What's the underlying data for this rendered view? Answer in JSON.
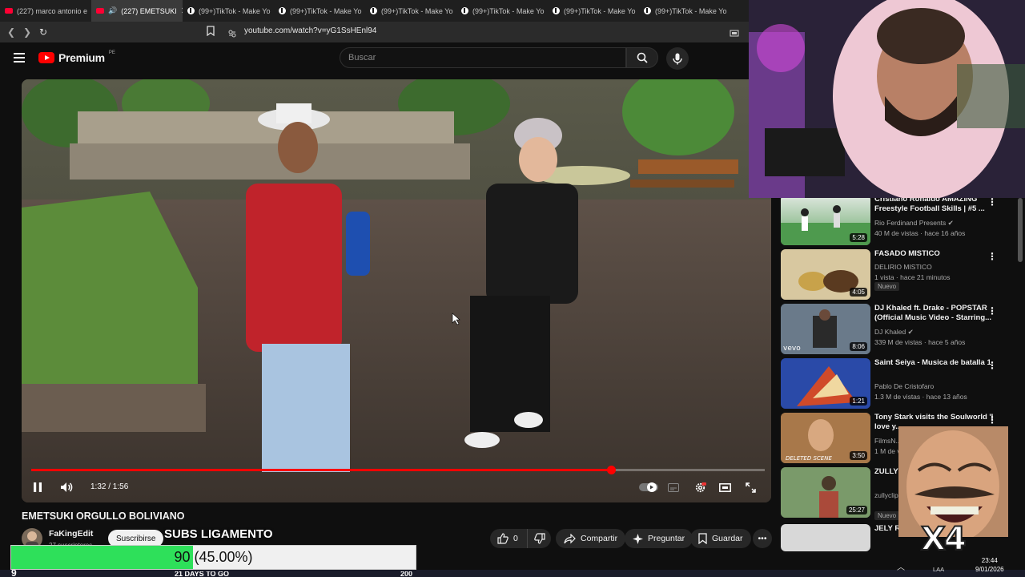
{
  "browser": {
    "tabs": [
      {
        "label": "(227) marco antonio e",
        "icon": "youtube-icon",
        "active": false
      },
      {
        "label": "(227) EMETSUKI",
        "icon": "youtube-icon",
        "active": true
      },
      {
        "label": "(99+)TikTok - Make Yo",
        "icon": "tiktok-icon",
        "active": false
      },
      {
        "label": "(99+)TikTok - Make Yo",
        "icon": "tiktok-icon",
        "active": false
      },
      {
        "label": "(99+)TikTok - Make Yo",
        "icon": "tiktok-icon",
        "active": false
      },
      {
        "label": "(99+)TikTok - Make Yo",
        "icon": "tiktok-icon",
        "active": false
      },
      {
        "label": "(99+)TikTok - Make Yo",
        "icon": "tiktok-icon",
        "active": false
      },
      {
        "label": "(99+)TikTok - Make Yo",
        "icon": "tiktok-icon",
        "active": false
      }
    ],
    "url": "youtube.com/watch?v=yG1SsHEnl94"
  },
  "youtube": {
    "logo_text": "Premium",
    "region": "PE",
    "search_placeholder": "Buscar"
  },
  "player": {
    "time": "1:32 / 1:56",
    "progress_fraction": 0.79
  },
  "video": {
    "title": "EMETSUKI ORGULLO BOLIVIANO",
    "channel": "FaKingEdit",
    "subscribers": "27 suscriptores",
    "subscribe_label": "Suscribirse",
    "likes": "0",
    "share_label": "Compartir",
    "ask_label": "Preguntar",
    "save_label": "Guardar"
  },
  "overlay": {
    "subs_caption": "SUBS LIGAMENTO",
    "goal_text": "90 (45.00%)",
    "goal_fraction": 0.45,
    "goal_sub": "21 DAYS TO GO",
    "goal_target": "200",
    "multiplier": "X4",
    "corner_number": "9"
  },
  "recommendations": [
    {
      "title": "Cristiano Ronaldo AMAZING Freestyle Football Skills | #5 ...",
      "channel": "Rio Ferdinand Presents",
      "verified": true,
      "meta": "40 M de vistas · hace 16 años",
      "duration": "5:28",
      "new": false
    },
    {
      "title": "FASADO MISTICO",
      "channel": "DELIRIO MISTICO",
      "verified": false,
      "meta": "1 vista · hace 21 minutos",
      "duration": "4:05",
      "new": true,
      "new_label": "Nuevo"
    },
    {
      "title": "DJ Khaled ft. Drake - POPSTAR (Official Music Video - Starring...",
      "channel": "DJ Khaled",
      "verified": true,
      "meta": "339 M de vistas · hace 5 años",
      "duration": "8:06",
      "new": false
    },
    {
      "title": "Saint Seiya - Musica de batalla 1",
      "channel": "Pablo De Cristofaro",
      "verified": false,
      "meta": "1.3 M de vistas · hace 13 años",
      "duration": "1:21",
      "new": false
    },
    {
      "title": "Tony Stark visits the Soulworld 'I love y...",
      "channel": "FilmsN...",
      "verified": false,
      "meta": "1 M de v...",
      "duration": "3:50",
      "new": false
    },
    {
      "title": "ZULLY ... BASE M...",
      "channel": "zullyclip...",
      "verified": false,
      "meta": "",
      "duration": "25:27",
      "new": true,
      "new_label": "Nuevo"
    },
    {
      "title": "JELY R... NN",
      "channel": "",
      "verified": false,
      "meta": "",
      "duration": "",
      "new": false
    }
  ],
  "taskbar": {
    "time": "23:44",
    "date": "9/01/2026",
    "lang": "LAA"
  }
}
